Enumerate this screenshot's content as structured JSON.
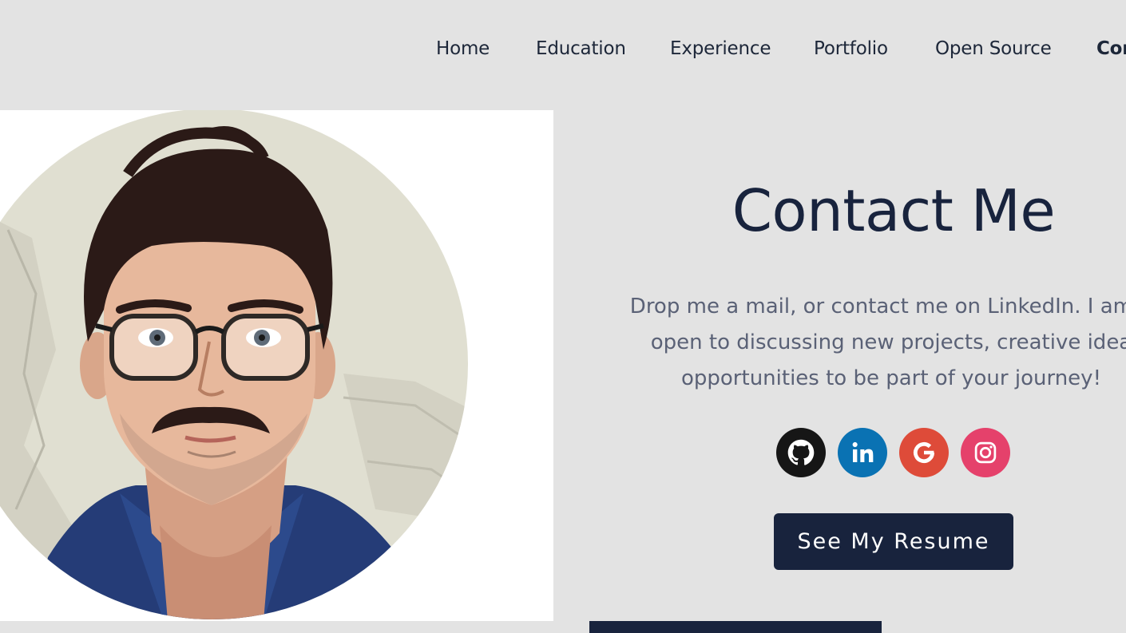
{
  "nav": {
    "items": [
      {
        "label": "Home"
      },
      {
        "label": "Education"
      },
      {
        "label": "Experience"
      },
      {
        "label": "Portfolio"
      },
      {
        "label": "Open Source"
      },
      {
        "label": "Cor"
      }
    ]
  },
  "contact": {
    "title": "Contact Me",
    "lines": [
      "Drop me a mail, or contact me on LinkedIn. I am a",
      "open to discussing new projects, creative idea",
      "opportunities to be part of your journey!"
    ],
    "resume_label": "See My Resume"
  },
  "socials": [
    {
      "name": "github-icon",
      "color": "#161616"
    },
    {
      "name": "linkedin-icon",
      "color": "#0a72b3"
    },
    {
      "name": "google-icon",
      "color": "#de4b39"
    },
    {
      "name": "instagram-icon",
      "color": "#e5416b"
    }
  ],
  "colors": {
    "background": "#e3e3e3",
    "primary": "#18233d",
    "text_muted": "#5a6176"
  }
}
